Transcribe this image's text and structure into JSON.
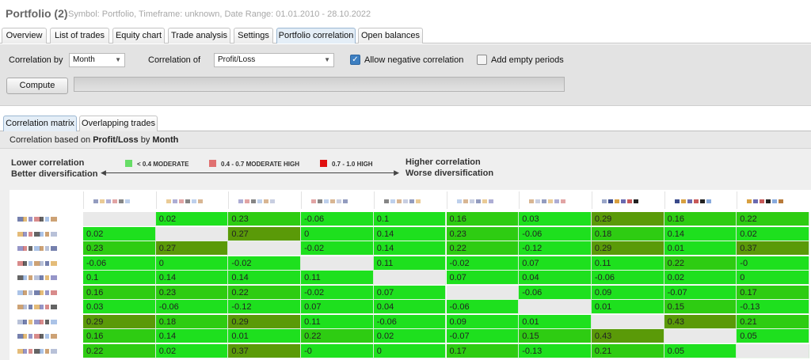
{
  "header": {
    "title": "Portfolio (2)",
    "subtitle": "Symbol: Portfolio, Timeframe: unknown, Date Range: 01.01.2010 - 28.10.2022"
  },
  "tabs": [
    {
      "label": "Overview"
    },
    {
      "label": "List of trades"
    },
    {
      "label": "Equity chart"
    },
    {
      "label": "Trade analysis"
    },
    {
      "label": "Settings"
    },
    {
      "label": "Portfolio correlation",
      "active": true
    },
    {
      "label": "Open balances"
    }
  ],
  "toolbar": {
    "correlation_by_label": "Correlation by",
    "correlation_by_value": "Month",
    "correlation_of_label": "Correlation of",
    "correlation_of_value": "Profit/Loss",
    "allow_negative_label": "Allow negative correlation",
    "allow_negative_checked": true,
    "add_empty_label": "Add empty periods",
    "add_empty_checked": false,
    "compute_label": "Compute"
  },
  "subtabs": [
    {
      "label": "Correlation matrix",
      "active": true
    },
    {
      "label": "Overlapping trades"
    }
  ],
  "panel": {
    "caption_prefix": "Correlation based on ",
    "caption_of": "Profit/Loss",
    "caption_mid": " by ",
    "caption_by": "Month",
    "lower_line1": "Lower correlation",
    "lower_line2": "Better diversification",
    "higher_line1": "Higher correlation",
    "higher_line2": "Worse diversification",
    "legend": [
      {
        "label": "< 0.4 MODERATE",
        "color": "#66dd66"
      },
      {
        "label": "0.4 - 0.7 MODERATE HIGH",
        "color": "#e07070"
      },
      {
        "label": "0.7 - 1.0 HIGH",
        "color": "#e01010"
      }
    ]
  },
  "matrix": {
    "colors": {
      "low": "#1ee01e",
      "mid": "#2ecc12",
      "high": "#5a9a08",
      "diag": "#e9e9e9"
    },
    "rows": [
      [
        "",
        "0.02",
        "0.23",
        "-0.06",
        "0.1",
        "0.16",
        "0.03",
        "0.29",
        "0.16",
        "0.22"
      ],
      [
        "0.02",
        "",
        "0.27",
        "0",
        "0.14",
        "0.23",
        "-0.06",
        "0.18",
        "0.14",
        "0.02"
      ],
      [
        "0.23",
        "0.27",
        "",
        "-0.02",
        "0.14",
        "0.22",
        "-0.12",
        "0.29",
        "0.01",
        "0.37"
      ],
      [
        "-0.06",
        "0",
        "-0.02",
        "",
        "0.11",
        "-0.02",
        "0.07",
        "0.11",
        "0.22",
        "-0"
      ],
      [
        "0.1",
        "0.14",
        "0.14",
        "0.11",
        "",
        "0.07",
        "0.04",
        "-0.06",
        "0.02",
        "0"
      ],
      [
        "0.16",
        "0.23",
        "0.22",
        "-0.02",
        "0.07",
        "",
        "-0.06",
        "0.09",
        "-0.07",
        "0.17"
      ],
      [
        "0.03",
        "-0.06",
        "-0.12",
        "0.07",
        "0.04",
        "-0.06",
        "",
        "0.01",
        "0.15",
        "-0.13"
      ],
      [
        "0.29",
        "0.18",
        "0.29",
        "0.11",
        "-0.06",
        "0.09",
        "0.01",
        "",
        "0.43",
        "0.21"
      ],
      [
        "0.16",
        "0.14",
        "0.01",
        "0.22",
        "0.02",
        "-0.07",
        "0.15",
        "0.43",
        "",
        "0.05"
      ],
      [
        "0.22",
        "0.02",
        "0.37",
        "-0",
        "0",
        "0.17",
        "-0.13",
        "0.21",
        "0.05",
        ""
      ]
    ]
  }
}
